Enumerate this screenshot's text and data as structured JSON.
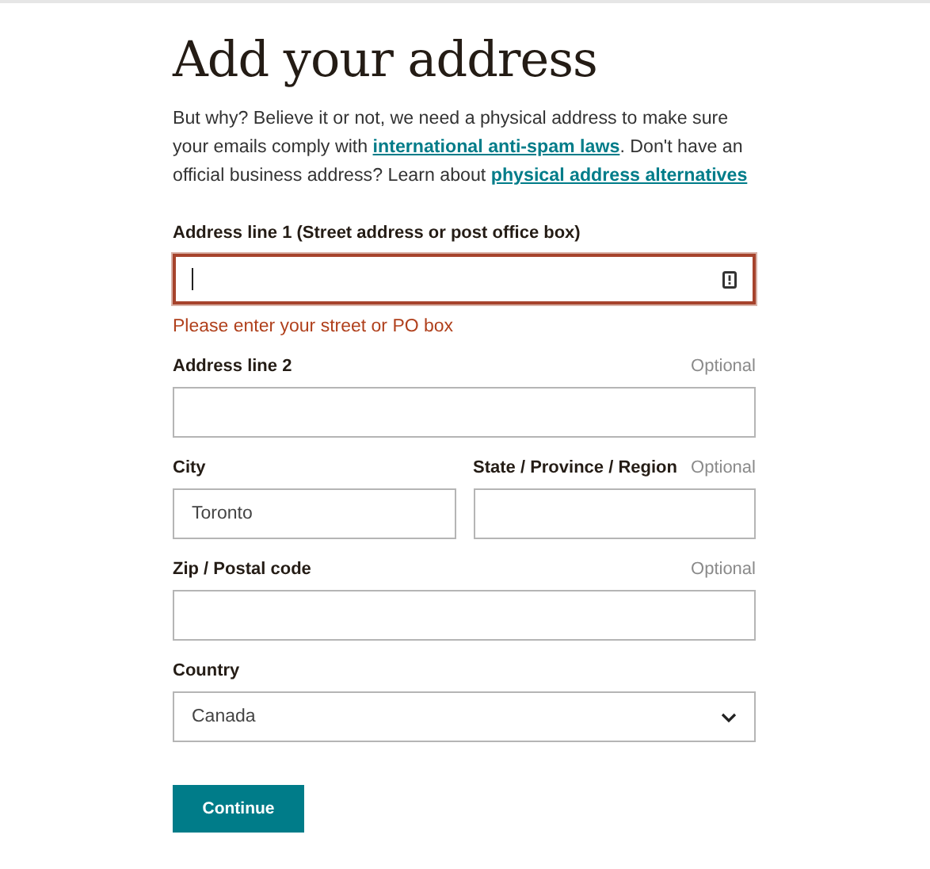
{
  "title": "Add your address",
  "intro": [
    {
      "kind": "text",
      "text": "But why? Believe it or not, we need a physical address to make sure your emails comply with "
    },
    {
      "kind": "link",
      "text": "international anti-spam laws"
    },
    {
      "kind": "text",
      "text": ". Don't have an official business address? Learn about "
    },
    {
      "kind": "link",
      "text": "physical address alternatives"
    }
  ],
  "rows": [
    {
      "fields": [
        {
          "kind": "text",
          "label": "Address line 1 (Street address or post office box)",
          "focused": true,
          "invalid": true,
          "error": "Please enter your street or PO box"
        }
      ]
    },
    {
      "fields": [
        {
          "kind": "text",
          "label": "Address line 2",
          "optional": "Optional",
          "focused": false,
          "invalid": false
        }
      ]
    },
    {
      "fields": [
        {
          "kind": "text",
          "label": "City",
          "value": "Toronto",
          "focused": false,
          "invalid": false
        },
        {
          "kind": "text",
          "label": "State / Province / Region",
          "optional": "Optional",
          "focused": false,
          "invalid": false
        }
      ]
    },
    {
      "fields": [
        {
          "kind": "text",
          "label": "Zip / Postal code",
          "optional": "Optional",
          "focused": false,
          "invalid": false
        }
      ]
    },
    {
      "fields": [
        {
          "kind": "select",
          "label": "Country",
          "value": "Canada"
        }
      ]
    }
  ],
  "button": "Continue"
}
